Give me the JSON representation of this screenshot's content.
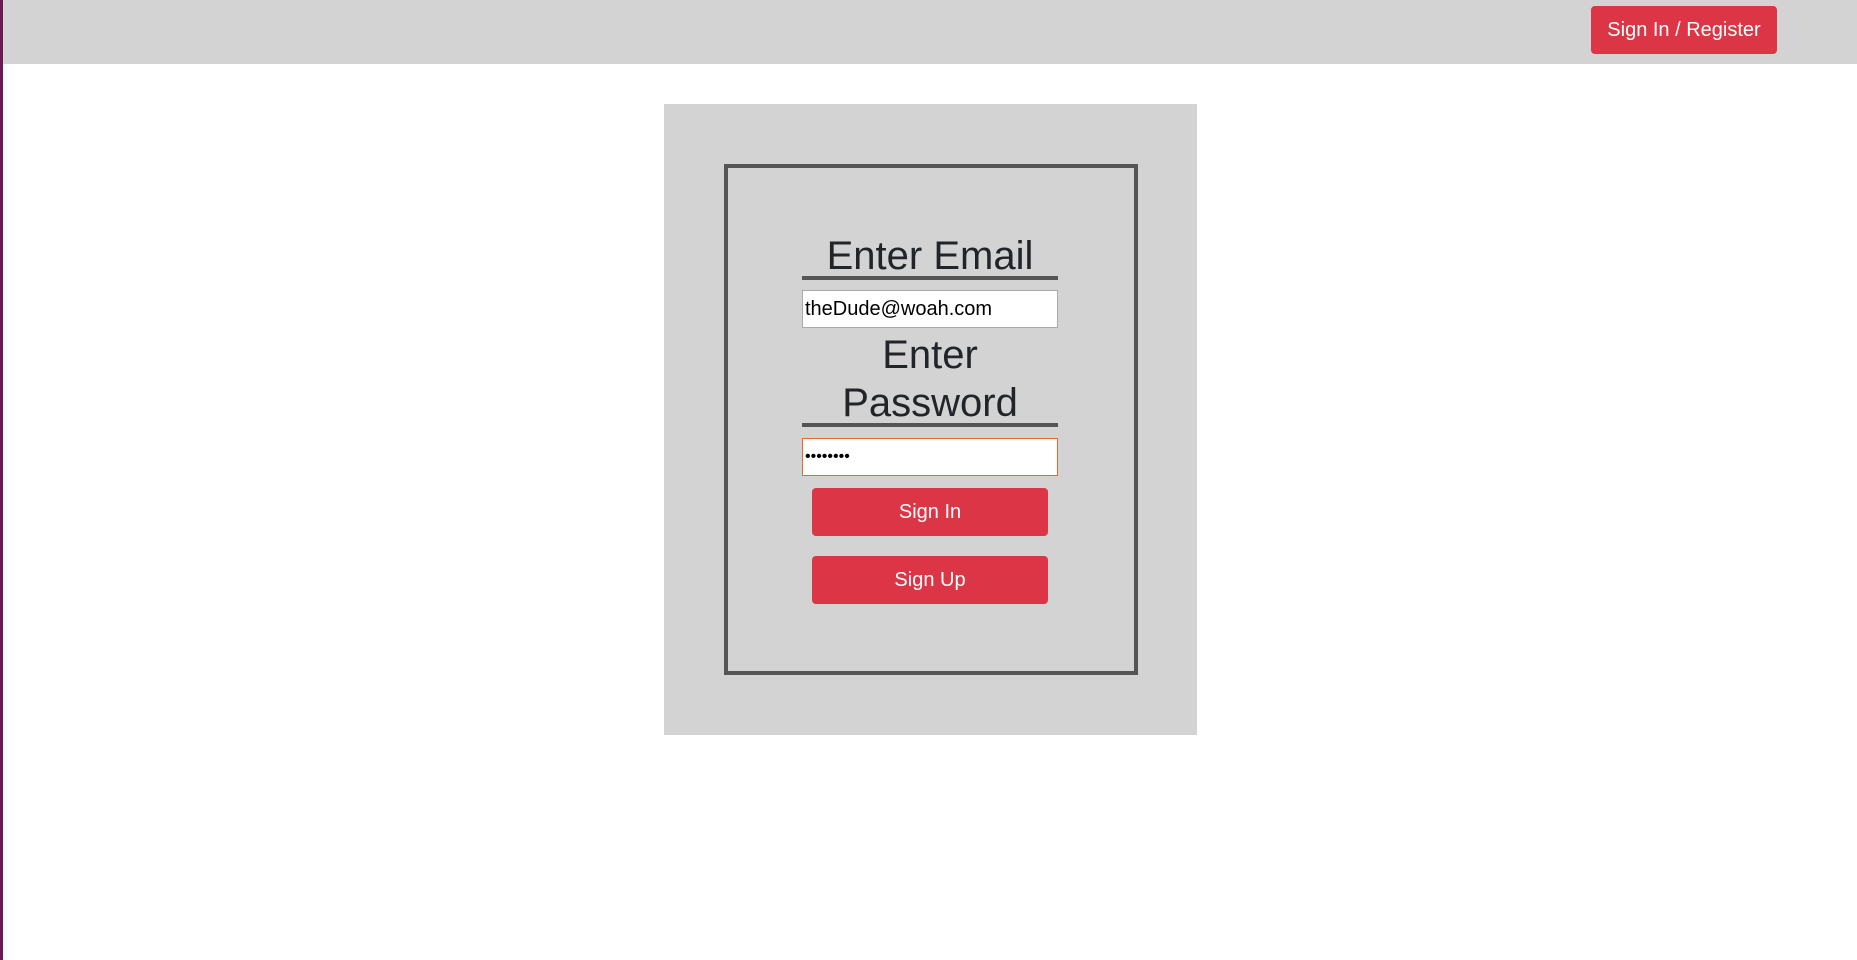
{
  "colors": {
    "topbar_bg": "#d3d3d3",
    "panel_bg": "#d3d3d3",
    "accent_red": "#dc3545",
    "border_dark": "#555555",
    "left_edge": "#6b1a4f",
    "password_focus_border": "#e8692b"
  },
  "header": {
    "signin_register_label": "Sign In / Register"
  },
  "form": {
    "email_heading": "Enter Email",
    "email_value": "theDude@woah.com",
    "password_heading": "Enter Password",
    "password_value": "••••••••",
    "signin_label": "Sign In",
    "signup_label": "Sign Up"
  }
}
